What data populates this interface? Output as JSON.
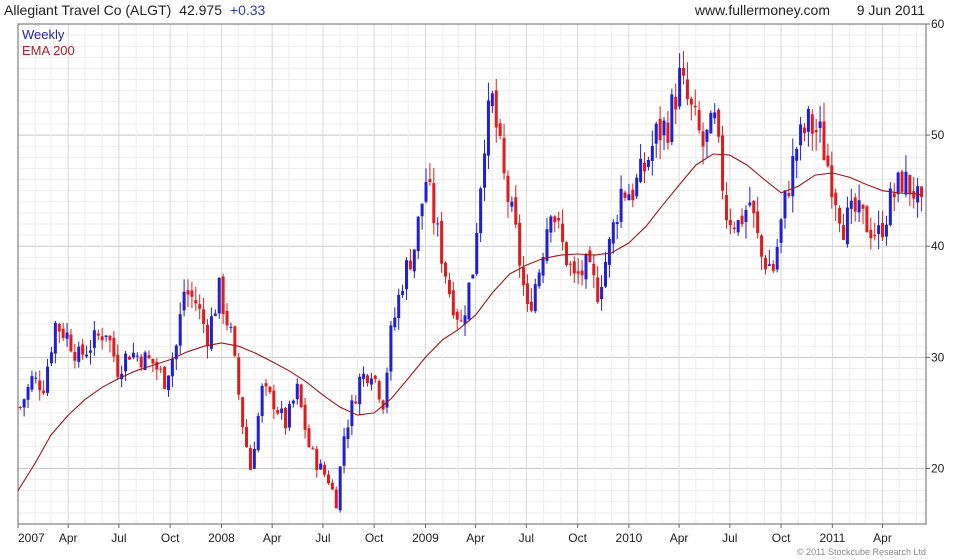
{
  "header": {
    "ticker": "Allegiant Travel Co (ALGT)",
    "price": "42.975",
    "change": "+0.33",
    "site": "www.fullermoney.com",
    "date": "9 Jun 2011"
  },
  "legend": {
    "weekly": "Weekly",
    "ema": "EMA 200"
  },
  "copyright": "© 2011 Stockcube Research Ltd",
  "colors": {
    "up": "#1f1fd6",
    "down": "#e01b1b",
    "ema": "#9b1a1a",
    "grid": "#dcdcdc",
    "minorgrid": "#eeeeee",
    "border": "#666666"
  },
  "chart_data": {
    "type": "candlestick",
    "title": "Allegiant Travel Co (ALGT)",
    "ylim": [
      15,
      60
    ],
    "y_ticks": [
      20,
      30,
      40,
      50,
      60
    ],
    "x_range": [
      "2007-01-01",
      "2011-06-18"
    ],
    "x_ticks": [
      {
        "label": "2007",
        "date": "2007-01-01"
      },
      {
        "label": "Apr",
        "date": "2007-04-01"
      },
      {
        "label": "Jul",
        "date": "2007-07-01"
      },
      {
        "label": "Oct",
        "date": "2007-10-01"
      },
      {
        "label": "2008",
        "date": "2008-01-01"
      },
      {
        "label": "Apr",
        "date": "2008-04-01"
      },
      {
        "label": "Jul",
        "date": "2008-07-01"
      },
      {
        "label": "Oct",
        "date": "2008-10-01"
      },
      {
        "label": "2009",
        "date": "2009-01-01"
      },
      {
        "label": "Apr",
        "date": "2009-04-01"
      },
      {
        "label": "Jul",
        "date": "2009-07-01"
      },
      {
        "label": "Oct",
        "date": "2009-10-01"
      },
      {
        "label": "2010",
        "date": "2010-01-01"
      },
      {
        "label": "Apr",
        "date": "2010-04-01"
      },
      {
        "label": "Jul",
        "date": "2010-07-01"
      },
      {
        "label": "Oct",
        "date": "2010-10-01"
      },
      {
        "label": "2011",
        "date": "2011-01-01"
      },
      {
        "label": "Apr",
        "date": "2011-04-01"
      }
    ],
    "series": [
      {
        "name": "Weekly",
        "close_path": [
          [
            "2007-01-05",
            25.5
          ],
          [
            "2007-01-26",
            28
          ],
          [
            "2007-02-16",
            27.5
          ],
          [
            "2007-03-09",
            33
          ],
          [
            "2007-03-30",
            32
          ],
          [
            "2007-04-20",
            30
          ],
          [
            "2007-05-18",
            31.5
          ],
          [
            "2007-06-08",
            32.5
          ],
          [
            "2007-06-29",
            29
          ],
          [
            "2007-07-20",
            30.5
          ],
          [
            "2007-08-10",
            30
          ],
          [
            "2007-08-31",
            29.5
          ],
          [
            "2007-09-21",
            28
          ],
          [
            "2007-10-12",
            31
          ],
          [
            "2007-10-26",
            36
          ],
          [
            "2007-11-16",
            35
          ],
          [
            "2007-12-07",
            32
          ],
          [
            "2007-12-28",
            36
          ],
          [
            "2008-01-18",
            32
          ],
          [
            "2008-02-08",
            24
          ],
          [
            "2008-02-22",
            20
          ],
          [
            "2008-03-14",
            27
          ],
          [
            "2008-04-04",
            26
          ],
          [
            "2008-04-25",
            24
          ],
          [
            "2008-05-16",
            27
          ],
          [
            "2008-06-06",
            22
          ],
          [
            "2008-06-20",
            20.5
          ],
          [
            "2008-07-11",
            19
          ],
          [
            "2008-07-25",
            17
          ],
          [
            "2008-08-08",
            23
          ],
          [
            "2008-09-05",
            28
          ],
          [
            "2008-09-26",
            29
          ],
          [
            "2008-10-17",
            26
          ],
          [
            "2008-10-31",
            32
          ],
          [
            "2008-11-21",
            37
          ],
          [
            "2008-12-12",
            40
          ],
          [
            "2009-01-02",
            46
          ],
          [
            "2009-01-23",
            41
          ],
          [
            "2009-02-13",
            36
          ],
          [
            "2009-03-06",
            33
          ],
          [
            "2009-03-27",
            38
          ],
          [
            "2009-04-17",
            50
          ],
          [
            "2009-05-01",
            53
          ],
          [
            "2009-05-22",
            46
          ],
          [
            "2009-06-12",
            41
          ],
          [
            "2009-07-03",
            34
          ],
          [
            "2009-07-24",
            38
          ],
          [
            "2009-08-14",
            44
          ],
          [
            "2009-09-04",
            40
          ],
          [
            "2009-09-25",
            37
          ],
          [
            "2009-10-16",
            38
          ],
          [
            "2009-11-06",
            36
          ],
          [
            "2009-11-27",
            40
          ],
          [
            "2009-12-18",
            45
          ],
          [
            "2010-01-08",
            45
          ],
          [
            "2010-01-29",
            47
          ],
          [
            "2010-02-19",
            50
          ],
          [
            "2010-03-12",
            51
          ],
          [
            "2010-04-02",
            55
          ],
          [
            "2010-04-23",
            52
          ],
          [
            "2010-05-14",
            49
          ],
          [
            "2010-06-04",
            51
          ],
          [
            "2010-06-25",
            43
          ],
          [
            "2010-07-16",
            42
          ],
          [
            "2010-08-06",
            44
          ],
          [
            "2010-08-27",
            39
          ],
          [
            "2010-09-17",
            38
          ],
          [
            "2010-10-08",
            44
          ],
          [
            "2010-10-29",
            49
          ],
          [
            "2010-11-19",
            51
          ],
          [
            "2010-12-10",
            50
          ],
          [
            "2010-12-31",
            46
          ],
          [
            "2011-01-21",
            42
          ],
          [
            "2011-02-11",
            43
          ],
          [
            "2011-03-04",
            42
          ],
          [
            "2011-03-25",
            41
          ],
          [
            "2011-04-15",
            44
          ],
          [
            "2011-05-06",
            46
          ],
          [
            "2011-05-27",
            45
          ],
          [
            "2011-06-10",
            42.975
          ]
        ]
      },
      {
        "name": "EMA 200",
        "values": [
          [
            "2007-01-01",
            18
          ],
          [
            "2007-02-01",
            20.5
          ],
          [
            "2007-03-01",
            23
          ],
          [
            "2007-04-01",
            24.8
          ],
          [
            "2007-05-01",
            26.2
          ],
          [
            "2007-06-01",
            27.3
          ],
          [
            "2007-07-01",
            28.1
          ],
          [
            "2007-08-01",
            28.8
          ],
          [
            "2007-09-01",
            29.3
          ],
          [
            "2007-10-01",
            29.8
          ],
          [
            "2007-11-01",
            30.5
          ],
          [
            "2007-12-01",
            31.0
          ],
          [
            "2008-01-01",
            31.3
          ],
          [
            "2008-02-01",
            31.0
          ],
          [
            "2008-03-01",
            30.4
          ],
          [
            "2008-04-01",
            29.6
          ],
          [
            "2008-05-01",
            28.8
          ],
          [
            "2008-06-01",
            27.8
          ],
          [
            "2008-07-01",
            26.6
          ],
          [
            "2008-08-01",
            25.5
          ],
          [
            "2008-09-01",
            24.8
          ],
          [
            "2008-10-01",
            25.0
          ],
          [
            "2008-11-01",
            26.3
          ],
          [
            "2008-12-01",
            28.1
          ],
          [
            "2009-01-01",
            30.0
          ],
          [
            "2009-02-01",
            31.6
          ],
          [
            "2009-03-01",
            32.5
          ],
          [
            "2009-04-01",
            33.8
          ],
          [
            "2009-05-01",
            35.8
          ],
          [
            "2009-06-01",
            37.5
          ],
          [
            "2009-07-01",
            38.3
          ],
          [
            "2009-08-01",
            38.9
          ],
          [
            "2009-09-01",
            39.2
          ],
          [
            "2009-10-01",
            39.3
          ],
          [
            "2009-11-01",
            39.2
          ],
          [
            "2009-12-01",
            39.4
          ],
          [
            "2010-01-01",
            40.3
          ],
          [
            "2010-02-01",
            41.8
          ],
          [
            "2010-03-01",
            43.6
          ],
          [
            "2010-04-01",
            45.5
          ],
          [
            "2010-05-01",
            47.3
          ],
          [
            "2010-06-01",
            48.3
          ],
          [
            "2010-07-01",
            48.2
          ],
          [
            "2010-08-01",
            47.3
          ],
          [
            "2010-09-01",
            46.0
          ],
          [
            "2010-10-01",
            44.8
          ],
          [
            "2010-11-01",
            45.4
          ],
          [
            "2010-12-01",
            46.4
          ],
          [
            "2011-01-01",
            46.6
          ],
          [
            "2011-02-01",
            46.2
          ],
          [
            "2011-03-01",
            45.6
          ],
          [
            "2011-04-01",
            45.0
          ],
          [
            "2011-05-01",
            44.8
          ],
          [
            "2011-06-01",
            44.7
          ],
          [
            "2011-06-10",
            44.6
          ]
        ]
      }
    ]
  }
}
